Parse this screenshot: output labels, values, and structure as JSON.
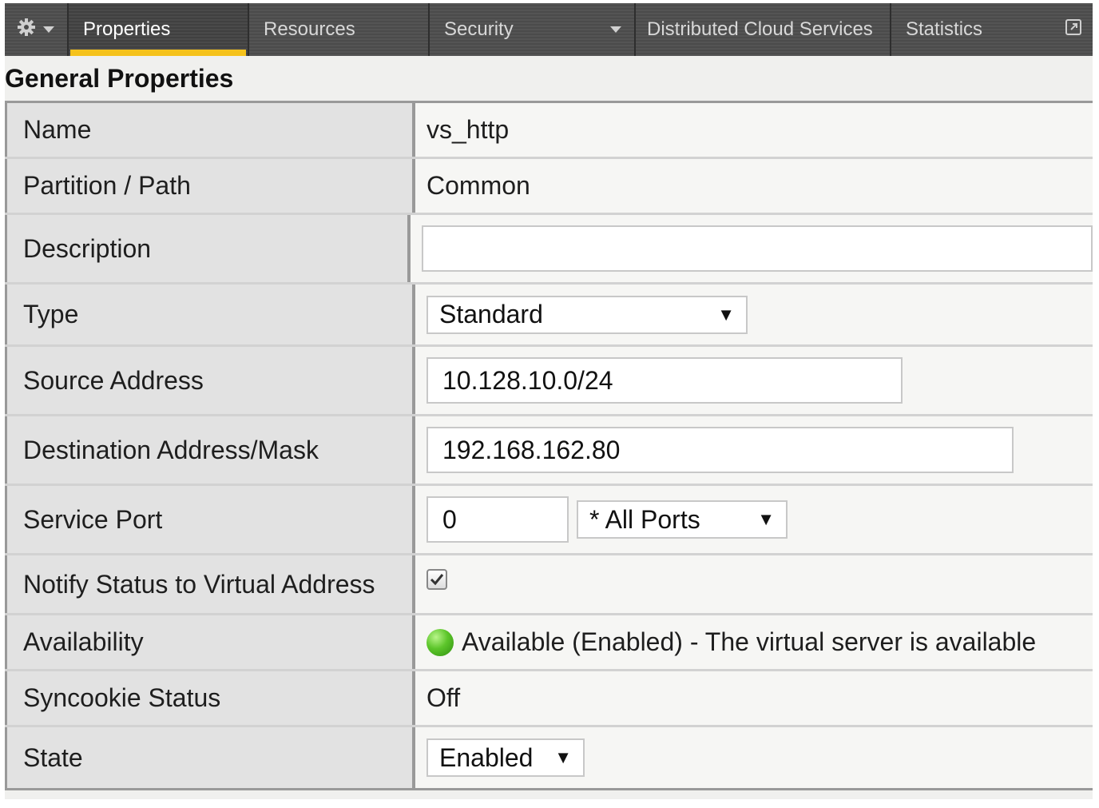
{
  "tabs": [
    {
      "label": "Properties",
      "active": true
    },
    {
      "label": "Resources"
    },
    {
      "label": "Security",
      "has_dropdown": true
    },
    {
      "label": "Distributed Cloud Services"
    },
    {
      "label": "Statistics"
    }
  ],
  "heading": "General Properties",
  "rows": {
    "name": {
      "label": "Name",
      "value": "vs_http"
    },
    "partition": {
      "label": "Partition / Path",
      "value": "Common"
    },
    "description": {
      "label": "Description",
      "value": ""
    },
    "type": {
      "label": "Type",
      "value": "Standard"
    },
    "source": {
      "label": "Source Address",
      "value": "10.128.10.0/24"
    },
    "destination": {
      "label": "Destination Address/Mask",
      "value": "192.168.162.80"
    },
    "service_port": {
      "label": "Service Port",
      "value": "0",
      "option": "* All Ports"
    },
    "notify": {
      "label": "Notify Status to Virtual Address",
      "checked": true
    },
    "availability": {
      "label": "Availability",
      "value": "Available (Enabled) - The virtual server is available",
      "status_color": "#5cc52a"
    },
    "syncookie": {
      "label": "Syncookie Status",
      "value": "Off"
    },
    "state": {
      "label": "State",
      "value": "Enabled"
    }
  },
  "colors": {
    "tab_accent": "#f5c21b",
    "tabbar": "#4a4a4a"
  },
  "icons": [
    "gear-icon",
    "chevron-down-icon",
    "popout-icon",
    "checkmark-icon",
    "status-dot-icon"
  ]
}
